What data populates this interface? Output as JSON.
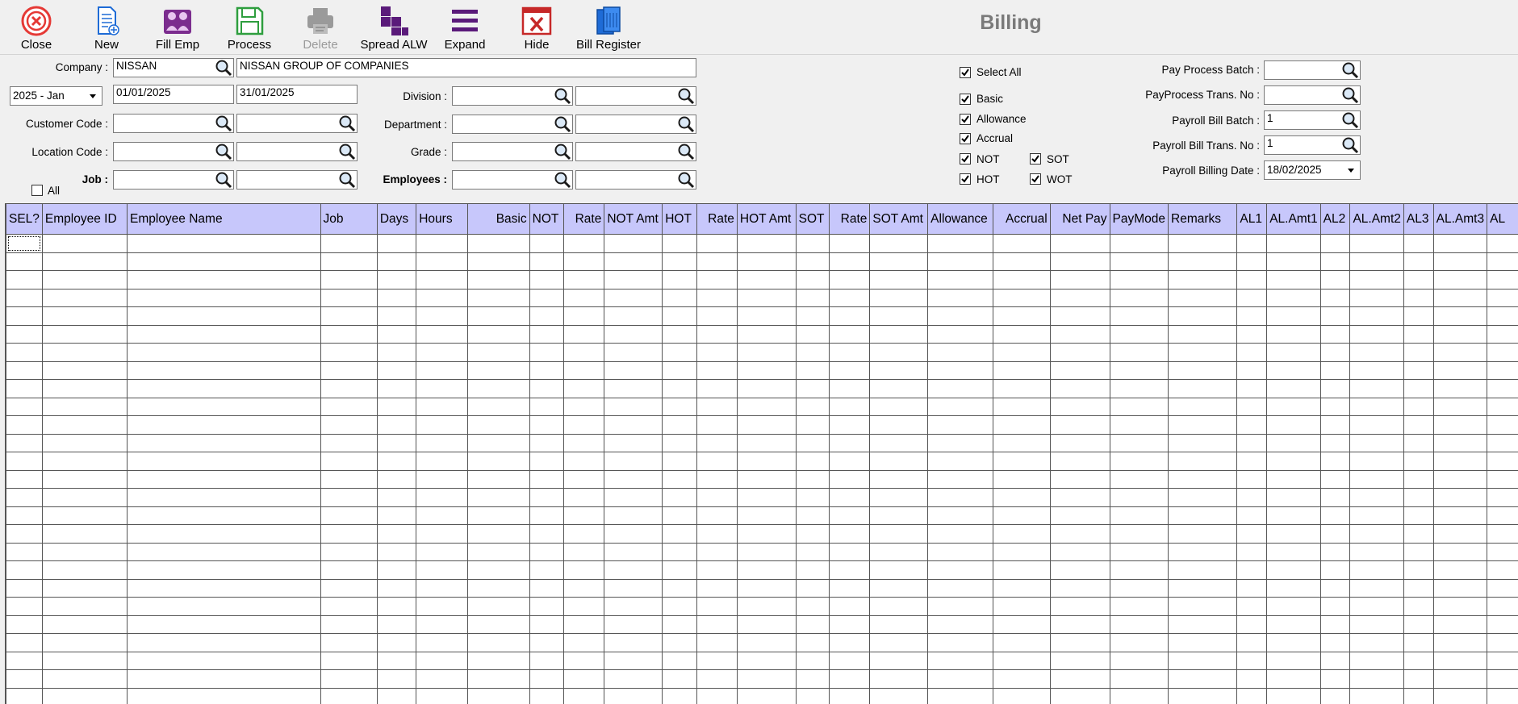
{
  "toolbar": {
    "buttons": [
      {
        "label": "Close",
        "icon": "close-icon"
      },
      {
        "label": "New",
        "icon": "new-document-icon"
      },
      {
        "label": "Fill Emp",
        "icon": "employees-icon"
      },
      {
        "label": "Process",
        "icon": "save-disk-icon"
      },
      {
        "label": "Delete",
        "icon": "delete-printer-icon",
        "disabled": true
      },
      {
        "label": "Spread ALW",
        "icon": "spread-icon"
      },
      {
        "label": "Expand",
        "icon": "expand-menu-icon"
      },
      {
        "label": "Hide",
        "icon": "hide-icon"
      },
      {
        "label": "Bill Register",
        "icon": "register-book-icon"
      }
    ]
  },
  "window_title": "Billing",
  "form": {
    "company_label": "Company :",
    "company_code": "NISSAN",
    "company_name": "NISSAN GROUP OF COMPANIES",
    "period": "2025 - Jan",
    "date_from": "01/01/2025",
    "date_to": "31/01/2025",
    "customer_code_label": "Customer Code :",
    "location_code_label": "Location Code :",
    "job_label": "Job :",
    "all_label": "All",
    "division_label": "Division :",
    "department_label": "Department :",
    "grade_label": "Grade :",
    "employees_label": "Employees :"
  },
  "checks": {
    "select_all": "Select All",
    "basic": "Basic",
    "allowance": "Allowance",
    "accrual": "Accrual",
    "not": "NOT",
    "sot": "SOT",
    "hot": "HOT",
    "wot": "WOT"
  },
  "payroll": {
    "pay_process_batch_label": "Pay Process Batch :",
    "pay_process_batch": "",
    "payprocess_trans_label": "PayProcess Trans. No :",
    "payprocess_trans": "",
    "payroll_bill_batch_label": "Payroll Bill Batch :",
    "payroll_bill_batch": "1",
    "payroll_bill_trans_label": "Payroll Bill Trans. No :",
    "payroll_bill_trans": "1",
    "payroll_billing_date_label": "Payroll Billing Date :",
    "payroll_billing_date": "18/02/2025"
  },
  "grid": {
    "columns": [
      "SEL?",
      "Employee ID",
      "Employee Name",
      "Job",
      "Days",
      "Hours",
      "Basic",
      "NOT",
      "Rate",
      "NOT Amt",
      "HOT",
      "Rate",
      "HOT Amt",
      "SOT",
      "Rate",
      "SOT Amt",
      "Allowance",
      "Accrual",
      "Net Pay",
      "PayMode",
      "Remarks",
      "AL1",
      "AL.Amt1",
      "AL2",
      "AL.Amt2",
      "AL3",
      "AL.Amt3",
      "AL"
    ],
    "right_aligned": [
      "Basic",
      "Rate",
      "Accrual",
      "Net Pay"
    ],
    "rows": []
  },
  "colors": {
    "header_bg": "#c7c7fb",
    "grid_lines": "#555555",
    "title": "#7a7a7a",
    "disabled_text": "#9a9a9a"
  }
}
